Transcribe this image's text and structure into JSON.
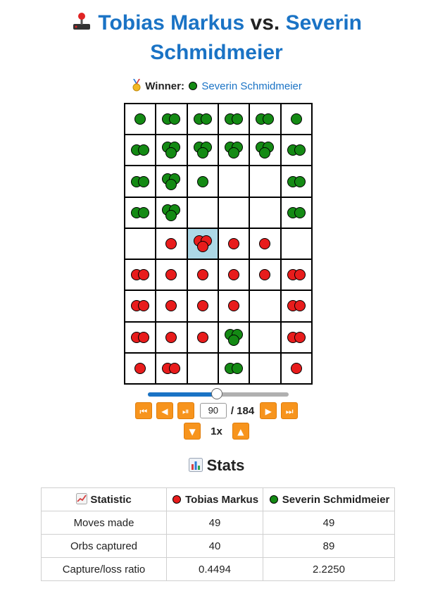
{
  "header": {
    "icon": "joystick-icon",
    "player1": "Tobias Markus",
    "vs": "vs.",
    "player2": "Severin Schmidmeier"
  },
  "winner": {
    "icon": "medal-icon",
    "label": "Winner:",
    "color": "green",
    "name": "Severin Schmidmeier"
  },
  "colors": {
    "red": "#e81c1c",
    "green": "#148a14",
    "highlight": "#add8e6",
    "accent": "#1a73c5",
    "button": "#f7941d"
  },
  "board": {
    "rows": 9,
    "cols": 6,
    "highlight": [
      4,
      2
    ],
    "cells": [
      [
        "g1",
        "g2",
        "g2",
        "g2",
        "g2",
        "g1"
      ],
      [
        "g2",
        "g3",
        "g3",
        "g3",
        "g3",
        "g2"
      ],
      [
        "g2",
        "g3",
        "g1",
        "",
        "",
        "g2"
      ],
      [
        "g2",
        "g3",
        "",
        "",
        "",
        "g2"
      ],
      [
        "",
        "r1",
        "r3",
        "r1",
        "r1",
        ""
      ],
      [
        "r2",
        "r1",
        "r1",
        "r1",
        "r1",
        "r2"
      ],
      [
        "r2",
        "r1",
        "r1",
        "r1",
        "",
        "r2"
      ],
      [
        "r2",
        "r1",
        "r1",
        "g3",
        "",
        "r2"
      ],
      [
        "r1",
        "r2",
        "",
        "g2",
        "",
        "r1"
      ]
    ]
  },
  "playback": {
    "current_move": "90",
    "total_moves": "/ 184",
    "progress": 0.49,
    "speed": "1x",
    "buttons": {
      "first": "⏮",
      "prev": "◀",
      "play_pause": "⏯",
      "next": "▶",
      "last": "⏭",
      "slower": "▼",
      "faster": "▲"
    }
  },
  "stats": {
    "title": "Stats",
    "icon": "bar-chart-icon",
    "columns": [
      {
        "label": "Statistic",
        "icon": "trend-chart-icon"
      },
      {
        "label": "Tobias Markus",
        "color": "red"
      },
      {
        "label": "Severin Schmidmeier",
        "color": "green"
      }
    ],
    "rows": [
      {
        "label": "Moves made",
        "p1": "49",
        "p2": "49"
      },
      {
        "label": "Orbs captured",
        "p1": "40",
        "p2": "89"
      },
      {
        "label": "Capture/loss ratio",
        "p1": "0.4494",
        "p2": "2.2250"
      }
    ]
  }
}
